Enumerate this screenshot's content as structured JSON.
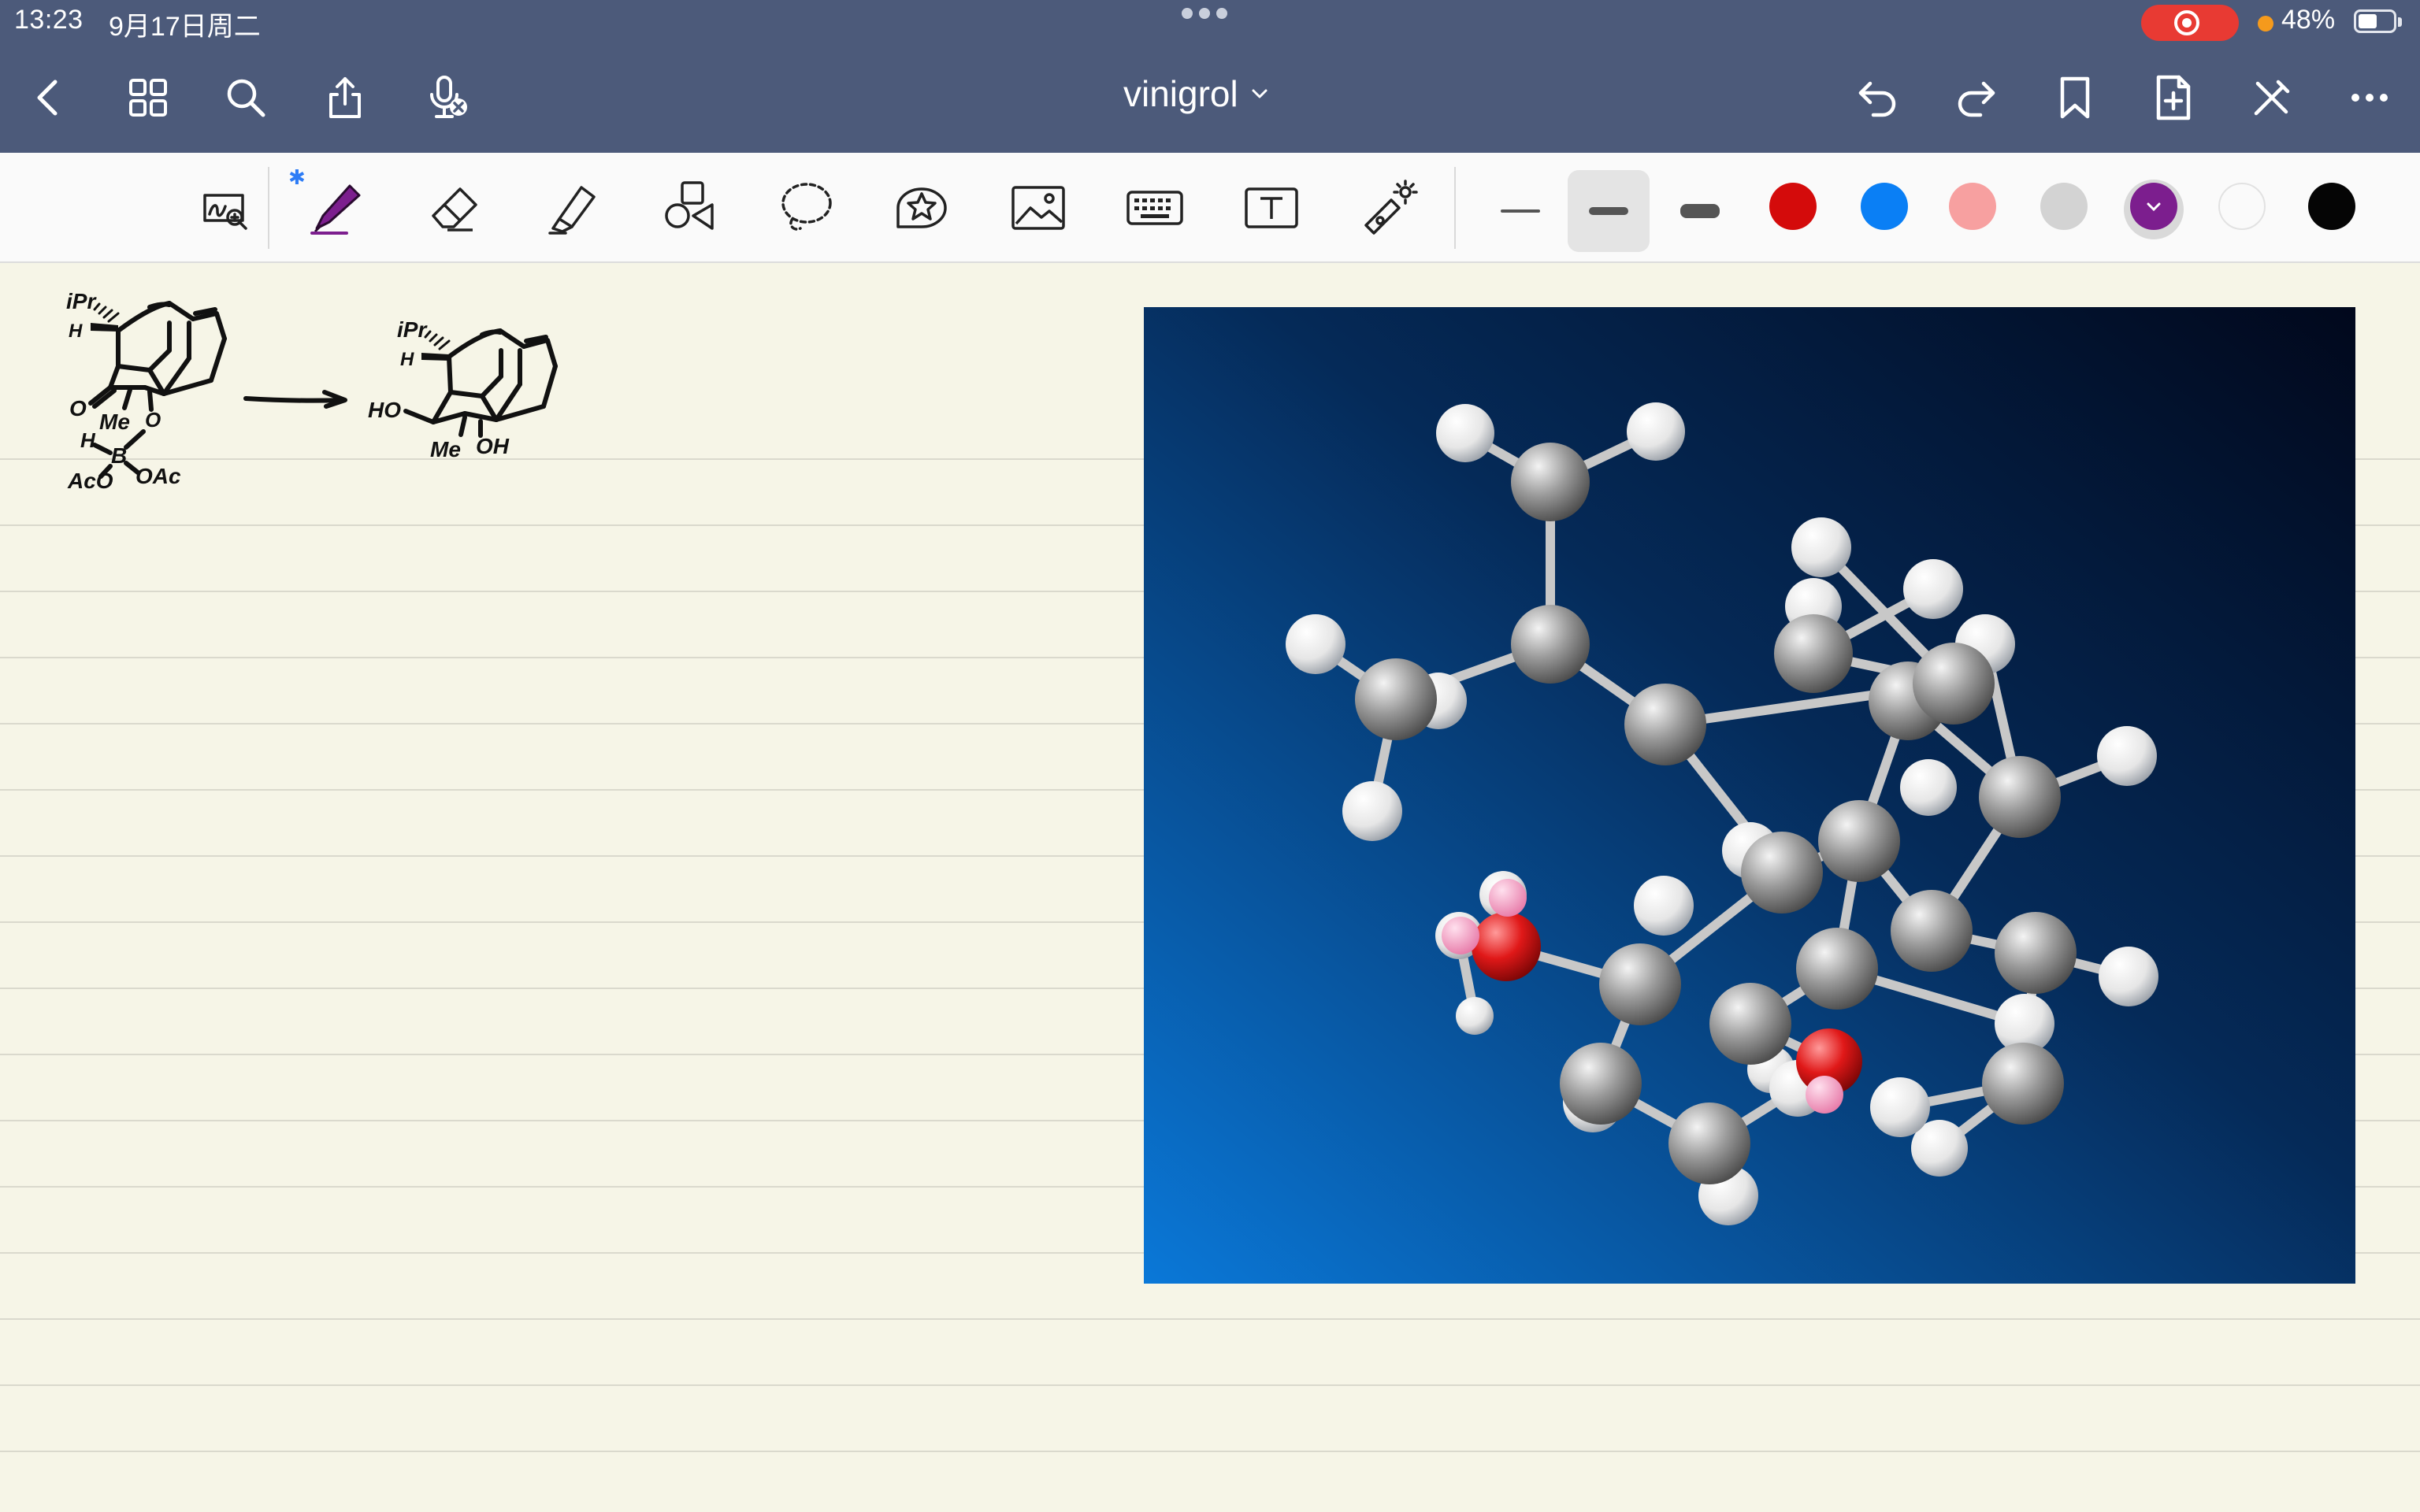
{
  "status_bar": {
    "time": "13:23",
    "date": "9月17日周二",
    "battery_percent": "48%",
    "battery_level": 0.48,
    "recording": true,
    "indicator_color": "#f59a1c"
  },
  "nav": {
    "title": "vinigrol",
    "back_icon": "chevron-left-icon",
    "left_icons": [
      "grid-icon",
      "search-icon",
      "share-icon",
      "microphone-icon"
    ],
    "right_icons": [
      "undo-icon",
      "redo-icon",
      "bookmark-icon",
      "add-page-icon",
      "pen-off-icon",
      "more-icon"
    ]
  },
  "toolbar": {
    "tools": [
      "zoom-window-icon",
      "pen-icon",
      "eraser-icon",
      "highlighter-icon",
      "shapes-icon",
      "lasso-icon",
      "sticker-icon",
      "image-icon",
      "keyboard-icon",
      "text-box-icon",
      "laser-pointer-icon"
    ],
    "selected_tool": "pen-icon",
    "stroke_widths": [
      "thin",
      "medium",
      "thick"
    ],
    "selected_stroke": "medium",
    "colors": [
      "#d40b0b",
      "#0a7ff5",
      "#f7a0a0",
      "#d3d3d3",
      "#7c1e8e",
      "#fafafa",
      "#050505"
    ],
    "selected_color": "#7c1e8e"
  },
  "handwriting": {
    "left_structure": [
      "iPr",
      "H",
      "O",
      "Me",
      "O",
      "H",
      "B",
      "AcO",
      "OAc"
    ],
    "right_structure": [
      "iPr",
      "H",
      "HO",
      "Me",
      "OH"
    ]
  },
  "image": {
    "subject": "ball-and-stick-molecule-model",
    "background_colors": [
      "#0a78d8",
      "#052a58",
      "#01081c"
    ]
  }
}
